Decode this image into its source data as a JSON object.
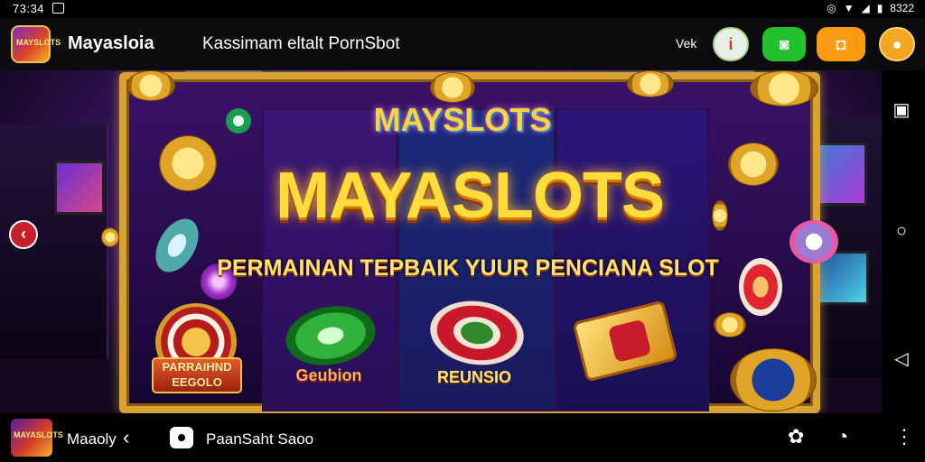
{
  "status_bar": {
    "time": "73:34",
    "battery_text": "8322",
    "icons": [
      "screenshot-icon",
      "alarm-icon",
      "wifi-icon",
      "signal-icon",
      "battery-icon"
    ]
  },
  "app_bar": {
    "app_name": "Mayasloia",
    "subtitle": "Kassimam eltalt PornSbot",
    "vek_label": "Vek",
    "actions": [
      {
        "name": "info-button",
        "icon": "info-icon",
        "glyph": "i",
        "color": "#e8efe8"
      },
      {
        "name": "chat-button",
        "icon": "chat-icon",
        "glyph": "◙",
        "color": "#22c22f"
      },
      {
        "name": "gallery-button",
        "icon": "gallery-icon",
        "glyph": "◘",
        "color": "#ff9b12"
      },
      {
        "name": "profile-button",
        "icon": "profile-icon",
        "glyph": "●",
        "color": "#f4a623"
      }
    ]
  },
  "game": {
    "logo_small": "MAYSLOTS",
    "logo_big": "MAYASLOTS",
    "tagline": "PERMAINAN TEPBAIK YUUR PENCIANA SLOT",
    "items": [
      {
        "label_line1": "PARRAIHND",
        "label_line2": "EEGOLO"
      },
      {
        "label": "Geubion"
      },
      {
        "label": "REUNSIO"
      },
      {
        "label": ""
      }
    ]
  },
  "bottom_bar": {
    "app_logo_text": "MAYASLOTS",
    "app_name": "Maaoly",
    "tab_label": "PaanSaht Saoo"
  },
  "colors": {
    "accent_gold": "#ffdc3a",
    "frame_gold": "#d9a332",
    "nav_red": "#c91f2a"
  }
}
